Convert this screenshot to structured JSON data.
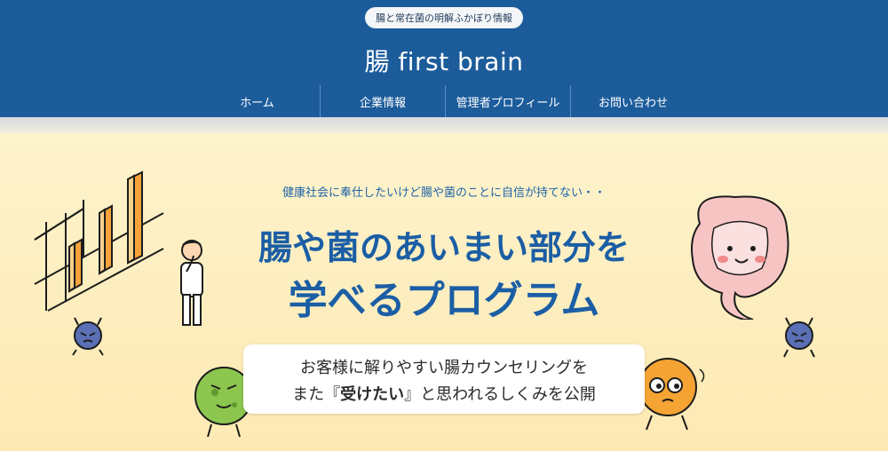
{
  "header": {
    "tagline": "腸と常在菌の明解ふかぼり情報",
    "title": "腸 first brain"
  },
  "nav": {
    "items": [
      "ホーム",
      "企業情報",
      "管理者プロフィール",
      "お問い合わせ"
    ]
  },
  "hero": {
    "lead": "健康社会に奉仕したいけど腸や菌のことに自信が持てない・・",
    "headline_line1": "腸や菌のあいまい部分を",
    "headline_line2": "学べるプログラム",
    "sub_line1": "お客様に解りやすい腸カウンセリングを",
    "sub_line2_pre": "また『",
    "sub_line2_bold": "受けたい",
    "sub_line2_post": "』と思われるしくみを公開"
  },
  "colors": {
    "header_bg": "#1c5c9b",
    "accent_blue": "#1b5ea5",
    "hero_bg": "#fdf0c4",
    "bar_orange": "#f5a33a"
  }
}
